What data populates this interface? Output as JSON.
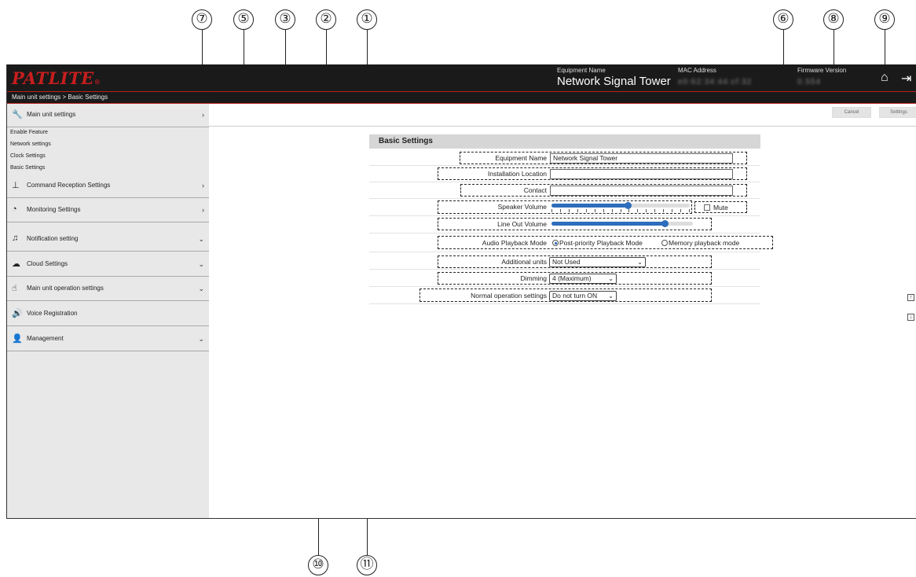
{
  "app": {
    "logo": "PATLITE",
    "logo_mark": "®",
    "breadcrumb": "Main unit settings > Basic Settings"
  },
  "header": {
    "equipment_name_label": "Equipment Name",
    "equipment_name_value": "Network Signal Tower",
    "mac_address_label": "MAC Address",
    "mac_address_value": "e0:62:34:44:cf:32",
    "firmware_version_label": "Firmware Version",
    "firmware_version_value": "0.554"
  },
  "toolbar": {
    "cancel_label": "Cancel",
    "settings_label": "Settings"
  },
  "sidebar": {
    "sections": [
      {
        "label": "Main unit settings",
        "icon": "wrench-icon",
        "chevron": "›"
      },
      {
        "label": "Command Reception Settings",
        "icon": "network-icon",
        "chevron": "›"
      },
      {
        "label": "Monitoring Settings",
        "icon": "gauge-icon",
        "chevron": "›"
      },
      {
        "label": "Notification setting",
        "icon": "bell-icon",
        "chevron": "⌄"
      },
      {
        "label": "Cloud Settings",
        "icon": "cloud-icon",
        "chevron": "⌄"
      },
      {
        "label": "Main unit operation settings",
        "icon": "hand-icon",
        "chevron": "⌄"
      },
      {
        "label": "Voice Registration",
        "icon": "speaker-icon",
        "chevron": ""
      },
      {
        "label": "Management",
        "icon": "user-icon",
        "chevron": "⌄"
      }
    ],
    "subitems": [
      "Enable Feature",
      "Network settings",
      "Clock Settings",
      "Basic Settings"
    ]
  },
  "main": {
    "section_title": "Basic Settings",
    "fields": {
      "equipment_name": {
        "label": "Equipment Name",
        "value": "Network Signal Tower"
      },
      "installation_location": {
        "label": "Installation Location",
        "value": ""
      },
      "contact": {
        "label": "Contact",
        "value": ""
      },
      "speaker_volume": {
        "label": "Speaker Volume",
        "level_fraction": 0.55,
        "mute_label": "Mute",
        "muted": false
      },
      "line_out_volume": {
        "label": "Line Out Volume",
        "level_fraction": 0.8
      },
      "audio_playback_mode": {
        "label": "Audio Playback Mode",
        "options": [
          "Post-priority Playback Mode",
          "Memory playback mode"
        ],
        "selected": 0
      },
      "additional_units": {
        "label": "Additional units",
        "value": "Not Used"
      },
      "dimming": {
        "label": "Dimming",
        "value": "4 (Maximum)"
      },
      "normal_operation_settings": {
        "label": "Normal operation settings",
        "value": "Do not turn ON"
      }
    }
  },
  "callouts": [
    "①",
    "②",
    "③",
    "⑤",
    "⑦",
    "⑥",
    "⑧",
    "⑨",
    "⑩",
    "⑪"
  ]
}
